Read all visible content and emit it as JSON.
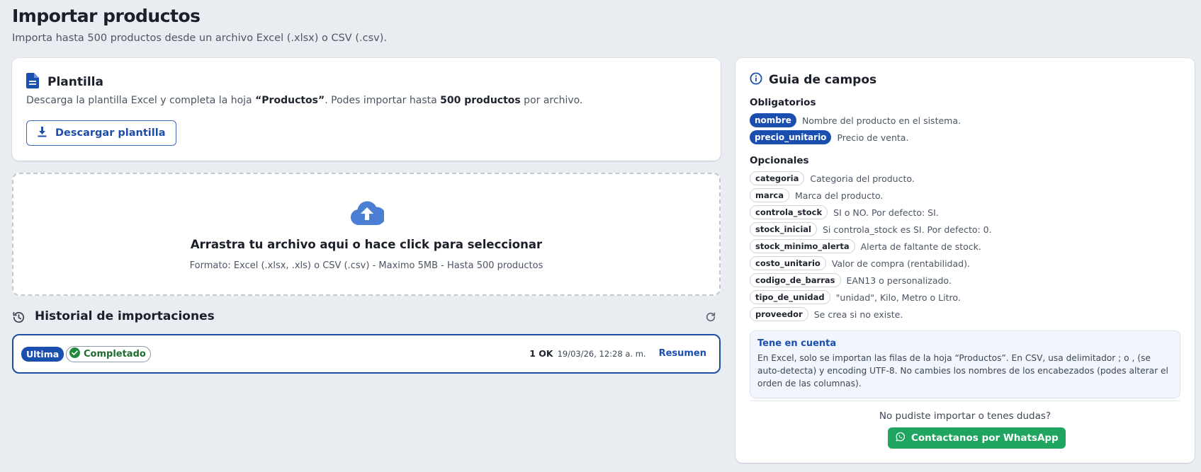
{
  "header": {
    "title": "Importar productos",
    "subtitle": "Importa hasta 500 productos desde un archivo Excel (.xlsx) o CSV (.csv)."
  },
  "plantilla": {
    "title": "Plantilla",
    "desc_pre": "Descarga la plantilla Excel y completa la hoja ",
    "desc_sheet": "“Productos”",
    "desc_mid": ". Podes importar hasta ",
    "desc_limit": "500 productos",
    "desc_post": " por archivo.",
    "button_label": "Descargar plantilla"
  },
  "dropzone": {
    "title": "Arrastra tu archivo aqui o hace click para seleccionar",
    "subtitle": "Formato: Excel (.xlsx, .xls) o CSV (.csv) - Maximo 5MB - Hasta 500 productos"
  },
  "historial": {
    "title": "Historial de importaciones",
    "rows": [
      {
        "badge": "Ultima",
        "status": "Completado",
        "ok_count": "1 OK",
        "date": "19/03/26, 12:28 a. m.",
        "link": "Resumen"
      }
    ]
  },
  "guia": {
    "title": "Guia de campos",
    "required_label": "Obligatorios",
    "required": [
      {
        "name": "nombre",
        "desc": "Nombre del producto en el sistema."
      },
      {
        "name": "precio_unitario",
        "desc": "Precio de venta."
      }
    ],
    "optional_label": "Opcionales",
    "optional": [
      {
        "name": "categoria",
        "desc": "Categoria del producto."
      },
      {
        "name": "marca",
        "desc": "Marca del producto."
      },
      {
        "name": "controla_stock",
        "desc": "SI o NO. Por defecto: SI."
      },
      {
        "name": "stock_inicial",
        "desc": "Si controla_stock es SI. Por defecto: 0."
      },
      {
        "name": "stock_minimo_alerta",
        "desc": "Alerta de faltante de stock."
      },
      {
        "name": "costo_unitario",
        "desc": "Valor de compra (rentabilidad)."
      },
      {
        "name": "codigo_de_barras",
        "desc": "EAN13 o personalizado."
      },
      {
        "name": "tipo_de_unidad",
        "desc": "\"unidad\", Kilo, Metro o Litro."
      },
      {
        "name": "proveedor",
        "desc": "Se crea si no existe."
      }
    ],
    "note_title": "Tene en cuenta",
    "note_text": "En Excel, solo se importan las filas de la hoja “Productos”. En CSV, usa delimitador ; o , (se auto-detecta) y encoding UTF-8. No cambies los nombres de los encabezados (podes alterar el orden de las columnas).",
    "help_text": "No pudiste importar o tenes dudas?",
    "whatsapp_label": "Contactanos por WhatsApp"
  },
  "colors": {
    "accent": "#1a4fb0",
    "success": "#1e6b2c",
    "whatsapp": "#1fa55f",
    "background": "#e9ecf1"
  },
  "icons": [
    "document-icon",
    "download-icon",
    "cloud-upload-icon",
    "history-icon",
    "refresh-icon",
    "check-circle-icon",
    "info-icon",
    "whatsapp-icon"
  ]
}
